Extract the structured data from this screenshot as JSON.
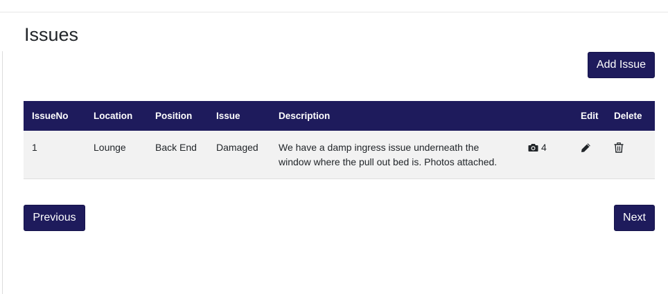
{
  "page": {
    "title": "Issues",
    "add_button_label": "Add Issue"
  },
  "table": {
    "headers": {
      "issue_no": "IssueNo",
      "location": "Location",
      "position": "Position",
      "issue": "Issue",
      "description": "Description",
      "photos": "",
      "edit": "Edit",
      "delete": "Delete"
    },
    "rows": [
      {
        "issue_no": "1",
        "location": "Lounge",
        "position": "Back End",
        "issue": "Damaged",
        "description": "We have a damp ingress issue underneath the window where the pull out bed is. Photos attached.",
        "photo_count": "4",
        "photo_icon": "camera-icon",
        "edit_icon": "pencil-icon",
        "delete_icon": "trash-icon"
      }
    ]
  },
  "pagination": {
    "previous_label": "Previous",
    "next_label": "Next"
  },
  "colors": {
    "primary": "#1e1b5c",
    "row_background": "#f2f2f2",
    "text": "#212529"
  }
}
